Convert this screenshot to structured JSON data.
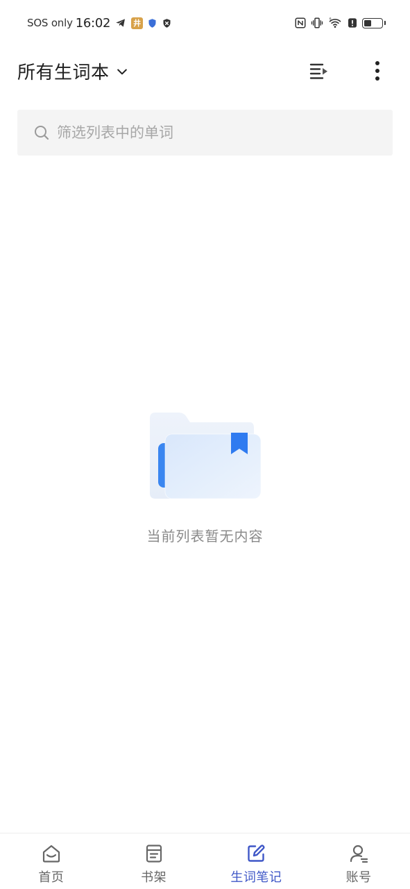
{
  "status_bar": {
    "carrier": "SOS only",
    "time": "16:02",
    "left_icons": [
      "telegram-icon",
      "app-badge-icon",
      "shield-icon",
      "vpn-x-icon"
    ],
    "app_badge_text": "井",
    "right_icons": [
      "nfc-icon",
      "vibrate-icon",
      "wifi-icon",
      "alert-icon",
      "battery-icon"
    ],
    "battery_level": 0.45
  },
  "header": {
    "title": "所有生词本",
    "title_chevron_icon": "chevron-down-icon",
    "sort_icon": "sort-list-icon",
    "more_icon": "more-vertical-icon"
  },
  "search": {
    "placeholder": "筛选列表中的单词",
    "value": ""
  },
  "empty_state": {
    "illustration": "empty-folder-bookmark-icon",
    "message": "当前列表暂无内容"
  },
  "bottom_nav": {
    "items": [
      {
        "label": "首页",
        "icon": "home-icon",
        "active": false
      },
      {
        "label": "书架",
        "icon": "bookshelf-icon",
        "active": false
      },
      {
        "label": "生词笔记",
        "icon": "edit-note-icon",
        "active": true
      },
      {
        "label": "账号",
        "icon": "account-icon",
        "active": false
      }
    ]
  },
  "colors": {
    "accent": "#3f57c7",
    "bookmark_blue": "#2f7bf0",
    "search_bg": "#f4f4f4",
    "text_secondary": "#8a8a8a"
  }
}
